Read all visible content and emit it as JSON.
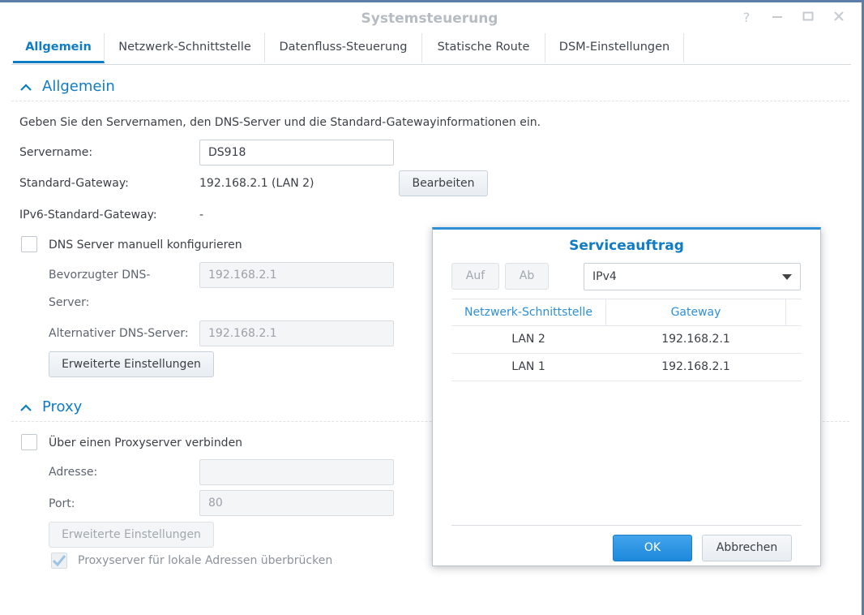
{
  "window": {
    "title": "Systemsteuerung",
    "controls": [
      "help-icon",
      "minimize-icon",
      "maximize-icon",
      "close-icon"
    ]
  },
  "tabs": [
    {
      "label": "Allgemein",
      "active": true
    },
    {
      "label": "Netzwerk-Schnittstelle",
      "active": false
    },
    {
      "label": "Datenfluss-Steuerung",
      "active": false
    },
    {
      "label": "Statische Route",
      "active": false
    },
    {
      "label": "DSM-Einstellungen",
      "active": false
    }
  ],
  "general": {
    "heading": "Allgemein",
    "description": "Geben Sie den Servernamen, den DNS-Server und die Standard-Gatewayinformationen ein.",
    "servername_label": "Servername:",
    "servername_value": "DS918",
    "gateway_label": "Standard-Gateway:",
    "gateway_value": "192.168.2.1 (LAN 2)",
    "edit_button": "Bearbeiten",
    "ipv6_label": "IPv6-Standard-Gateway:",
    "ipv6_value": "-",
    "dns_manual_label": "DNS Server manuell konfigurieren",
    "dns_manual_checked": false,
    "preferred_dns_label_1": "Bevorzugter DNS-",
    "preferred_dns_label_2": "Server:",
    "preferred_dns_value": "192.168.2.1",
    "alt_dns_label": "Alternativer DNS-Server:",
    "alt_dns_value": "192.168.2.1",
    "advanced_button": "Erweiterte Einstellungen"
  },
  "proxy": {
    "heading": "Proxy",
    "connect_label": "Über einen Proxyserver verbinden",
    "connect_checked": false,
    "address_label": "Adresse:",
    "address_value": "",
    "port_label": "Port:",
    "port_value": "80",
    "advanced_button": "Erweiterte Einstellungen",
    "bypass_label": "Proxyserver für lokale Adressen überbrücken",
    "bypass_checked": true
  },
  "dialog": {
    "title": "Serviceauftrag",
    "up_button": "Auf",
    "down_button": "Ab",
    "protocol_selected": "IPv4",
    "columns": [
      "Netzwerk-Schnittstelle",
      "Gateway"
    ],
    "rows": [
      {
        "interface": "LAN 2",
        "gateway": "192.168.2.1"
      },
      {
        "interface": "LAN 1",
        "gateway": "192.168.2.1"
      }
    ],
    "ok_button": "OK",
    "cancel_button": "Abbrechen"
  },
  "colors": {
    "accent": "#0f7cc4",
    "primary_button": "#2e8fd6",
    "window_border": "#5a7ea8"
  }
}
